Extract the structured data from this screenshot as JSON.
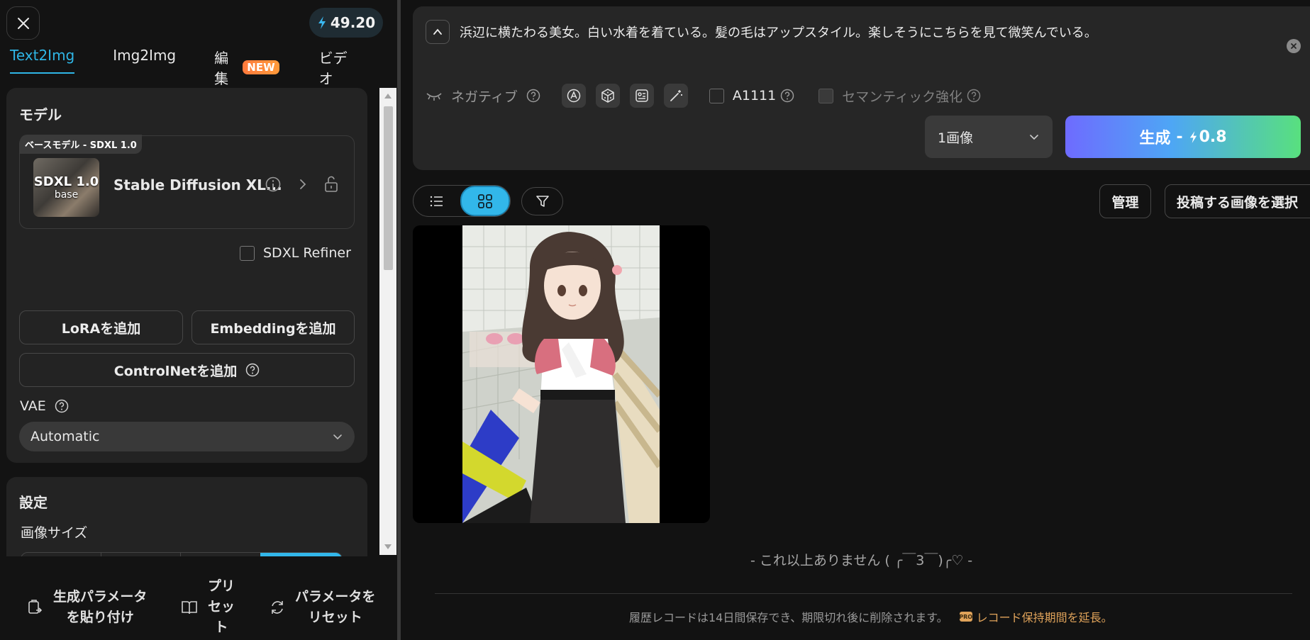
{
  "header": {
    "credits": "49.20"
  },
  "tabs": [
    {
      "label": "Text2Img"
    },
    {
      "label": "Img2Img"
    },
    {
      "label": "編集",
      "badge": "NEW"
    },
    {
      "label": "ビデオ"
    }
  ],
  "model": {
    "section_title": "モデル",
    "tag": "ベースモデル - SDXL 1.0",
    "thumb_title": "SDXL 1.0",
    "thumb_sub": "base",
    "name": "Stable Diffusion XL...",
    "refiner_label": "SDXL Refiner"
  },
  "buttons": {
    "add_lora": "LoRAを追加",
    "add_embedding": "Embeddingを追加",
    "add_controlnet": "ControlNetを追加"
  },
  "vae": {
    "label": "VAE",
    "value": "Automatic"
  },
  "settings": {
    "title": "設定",
    "image_size_label": "画像サイズ"
  },
  "bottom": {
    "paste_params": "生成パラメータ\nを貼り付け",
    "preset": "プリ\nセッ\nト",
    "reset_params": "パラメータを\nリセット"
  },
  "prompt": {
    "text": "浜辺に横たわる美女。白い水着を着ている。髪の毛はアップスタイル。楽しそうにこちらを見て微笑んでいる。",
    "negative_label": "ネガティブ",
    "a1111_label": "A1111",
    "semantic_label": "セマンティック強化",
    "count_value": "1画像",
    "generate_label": "生成",
    "generate_cost": "0.8"
  },
  "toolbar": {
    "manage": "管理",
    "select_post": "投稿する画像を選択"
  },
  "gallery": {
    "end_text": "- これ以上ありません ( ╭￣3￣)╭♡ -",
    "history_text": "履歴レコードは14日間保存でき、期限切れ後に削除されます。",
    "history_link": "レコード保持期間を延長。",
    "pro_badge": "PRO"
  },
  "colors": {
    "accent": "#2fb6e6",
    "new_badge": "#ff8a3a",
    "link": "#e0a35a"
  },
  "icons": [
    "close-icon",
    "bolt-icon",
    "info-icon",
    "chevron-right-icon",
    "unlock-icon",
    "help-icon",
    "chevron-down-icon",
    "collapse-up-icon",
    "clear-icon",
    "eye-closed-icon",
    "style-icon",
    "dice-icon",
    "image-prompt-icon",
    "magic-wand-icon",
    "list-view-icon",
    "grid-view-icon",
    "filter-icon",
    "paste-icon",
    "book-icon",
    "reset-icon"
  ]
}
